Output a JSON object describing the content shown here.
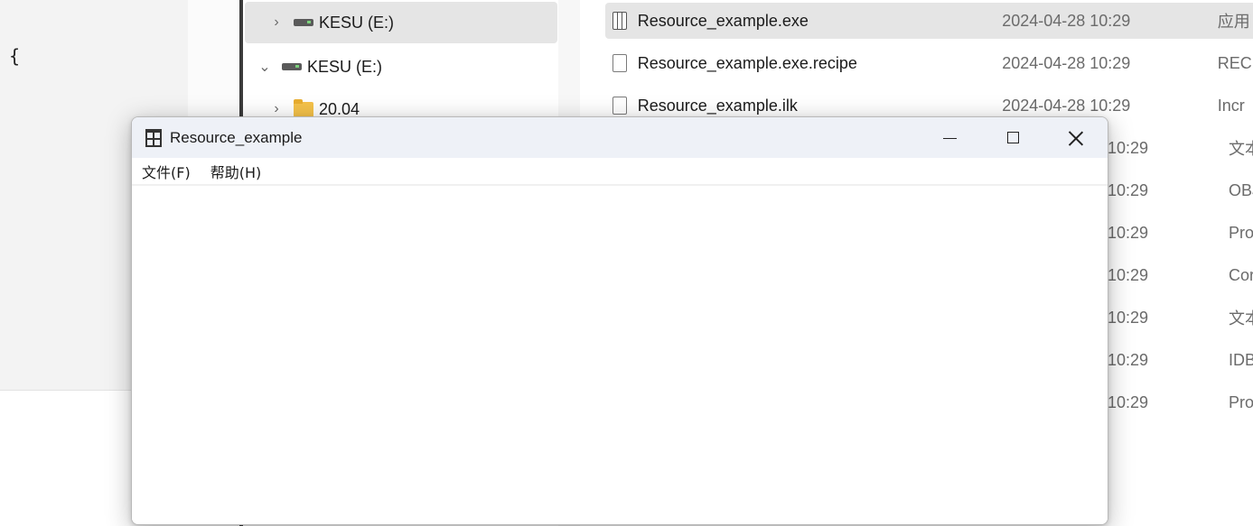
{
  "editor": {
    "text": "{"
  },
  "nav": {
    "items": [
      {
        "label": "KESU (E:)",
        "chevron": "›",
        "icon": "drive-icon",
        "selected": true
      },
      {
        "label": "KESU (E:)",
        "chevron": "⌄",
        "icon": "drive-icon",
        "selected": false
      },
      {
        "label": "20.04",
        "chevron": "›",
        "icon": "folder-icon",
        "selected": false
      }
    ]
  },
  "files": [
    {
      "name": "Resource_example.exe",
      "date": "2024-04-28 10:29",
      "type": "应用",
      "icon": "exe-icon",
      "selected": true
    },
    {
      "name": "Resource_example.exe.recipe",
      "date": "2024-04-28 10:29",
      "type": "REC",
      "icon": "file-icon",
      "selected": false
    },
    {
      "name": "Resource_example.ilk",
      "date": "2024-04-28 10:29",
      "type": "Incr",
      "icon": "file-icon",
      "selected": false
    }
  ],
  "hidden_rows": [
    {
      "time": "10:29",
      "type": "文本"
    },
    {
      "time": "10:29",
      "type": "OBJ"
    },
    {
      "time": "10:29",
      "type": "Pro"
    },
    {
      "time": "10:29",
      "type": "Cor"
    },
    {
      "time": "10:29",
      "type": "文本"
    },
    {
      "time": "10:29",
      "type": "IDB"
    },
    {
      "time": "10:29",
      "type": "Pro"
    }
  ],
  "app_window": {
    "title": "Resource_example",
    "icon": "gift-icon",
    "menu": {
      "file": "文件(F)",
      "help": "帮助(H)"
    },
    "controls": {
      "minimize": "minimize-icon",
      "maximize": "maximize-icon",
      "close": "close-icon"
    }
  },
  "colors": {
    "selected_row": "#e5e5e5",
    "title_bar": "#eef1f7",
    "folder": "#f5c24a"
  }
}
